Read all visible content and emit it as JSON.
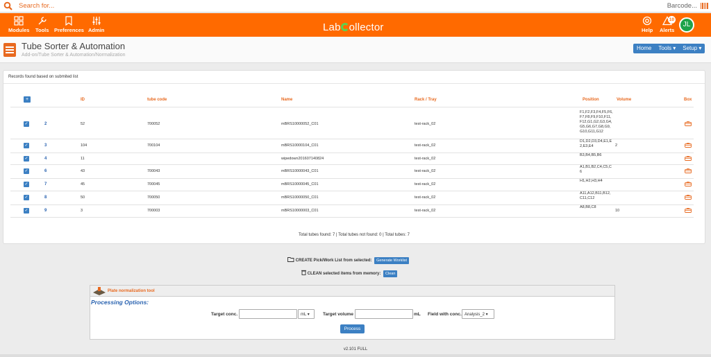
{
  "search": {
    "placeholder": "Search for...",
    "barcode_label": "Barcode..."
  },
  "nav": {
    "modules": "Modules",
    "tools": "Tools",
    "preferences": "Preferences",
    "admin": "Admin",
    "logo_left": "Lab",
    "logo_right": "ollector",
    "help": "Help",
    "alerts": "Alerts",
    "alerts_count": "10",
    "avatar_initials": "JL"
  },
  "header": {
    "title": "Tube Sorter & Automation",
    "breadcrumb": "Add-on/Tube Sorter & Automation/Normalization",
    "home": "Home",
    "tools": "Tools ▾",
    "setup": "Setup ▾"
  },
  "records": {
    "heading": "Records found based on submited list",
    "add_button": "+",
    "columns": {
      "id": "ID",
      "tube_code": "tube code",
      "name": "Name",
      "rack": "Rack / Tray",
      "position": "Position",
      "volume": "Volume",
      "box": "Box"
    },
    "rows": [
      {
        "n": "2",
        "id": "52",
        "code": "700052",
        "name": "mBRS10000052_C01",
        "rack": "test-rack_02",
        "position": "F1,F2,F3,F4,F5,F6,\nF7,F8,F9,F10,F11,\nF12,G1,G2,G3,G4,\nG5,G6,G7,G8,G9,\nG10,G11,G12",
        "volume": ""
      },
      {
        "n": "3",
        "id": "104",
        "code": "700104",
        "name": "mBRS10000104_C01",
        "rack": "test-rack_02",
        "position": "D1,D2,D3,D4,E1,E\n2,E3,E4",
        "volume": "2"
      },
      {
        "n": "4",
        "id": "11",
        "code": "",
        "name": "wipedown201607140824",
        "rack": "test-rack_02",
        "position": "B3,B4,B5,B6",
        "volume": ""
      },
      {
        "n": "6",
        "id": "43",
        "code": "700043",
        "name": "mBRS10000043_C01",
        "rack": "test-rack_02",
        "position": "A1,B1,B2,C4,C5,C\n6",
        "volume": ""
      },
      {
        "n": "7",
        "id": "45",
        "code": "700045",
        "name": "mBRS10000045_C01",
        "rack": "test-rack_02",
        "position": "H1,H2,H3,H4",
        "volume": ""
      },
      {
        "n": "8",
        "id": "50",
        "code": "700050",
        "name": "mBRS10000050_C01",
        "rack": "test-rack_02",
        "position": "A11,A12,B11,B12,\nC11,C12",
        "volume": ""
      },
      {
        "n": "9",
        "id": "3",
        "code": "700003",
        "name": "mBRS10000003_C01",
        "rack": "test-rack_02",
        "position": "A8,B8,C8",
        "volume": "10"
      }
    ],
    "totals": "Total tubes found: 7 | Total tubes not found: 0 | Total tubes: 7"
  },
  "actions": {
    "create_label": "CREATE Pick/Work List from selected:",
    "create_button": "Generate Worklist",
    "clean_label": "CLEAN selected items from memory:",
    "clean_button": "Clean"
  },
  "tool": {
    "title": "Plate normalization tool",
    "processing": "Processing Options:",
    "target_conc": "Target conc.",
    "unit": "mL",
    "target_volume": "Target volume",
    "volume_unit": "mL",
    "field_conc": "Field with conc.",
    "field_value": "Analysis_2",
    "process": "Process"
  },
  "version": "v2.101 FULL",
  "colors": {
    "accent": "#ff6a00",
    "primary": "#3c80c3",
    "link": "#2a63b0",
    "avatar": "#1ea34a"
  }
}
